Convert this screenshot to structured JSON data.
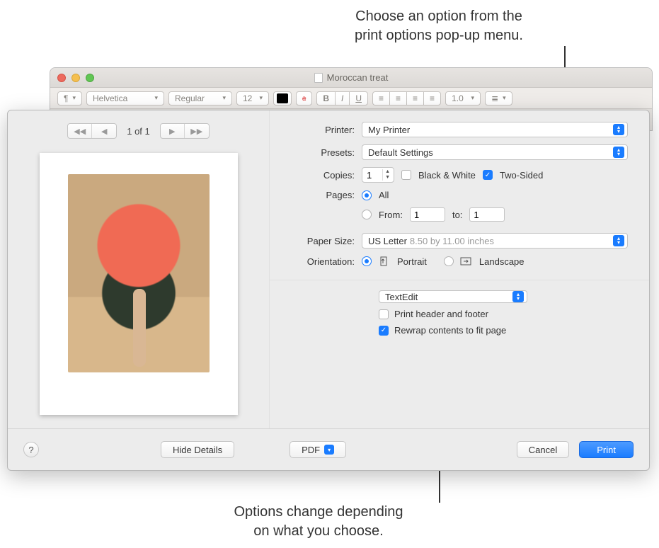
{
  "callouts": {
    "top": "Choose an option from the\nprint options pop-up menu.",
    "bottom": "Options change depending\non what you choose."
  },
  "parent_window": {
    "title": "Moroccan treat",
    "toolbar": {
      "para": "¶",
      "font": "Helvetica",
      "style": "Regular",
      "size": "12",
      "bold": "B",
      "italic": "I",
      "underline": "U",
      "spacing": "1.0"
    }
  },
  "print": {
    "nav": {
      "page_counter": "1 of 1"
    },
    "printer_label": "Printer:",
    "printer_value": "My Printer",
    "presets_label": "Presets:",
    "presets_value": "Default Settings",
    "copies_label": "Copies:",
    "copies_value": "1",
    "bw_label": "Black & White",
    "twosided_label": "Two-Sided",
    "pages_label": "Pages:",
    "pages_all": "All",
    "pages_from": "From:",
    "pages_from_val": "1",
    "pages_to": "to:",
    "pages_to_val": "1",
    "papersize_label": "Paper Size:",
    "papersize_value": "US Letter",
    "papersize_dim": "8.50 by 11.00 inches",
    "orientation_label": "Orientation:",
    "orientation_portrait": "Portrait",
    "orientation_landscape": "Landscape",
    "section_value": "TextEdit",
    "opt_header": "Print header and footer",
    "opt_rewrap": "Rewrap contents to fit page",
    "footer": {
      "hide_details": "Hide Details",
      "pdf": "PDF",
      "cancel": "Cancel",
      "print": "Print",
      "help": "?"
    }
  }
}
